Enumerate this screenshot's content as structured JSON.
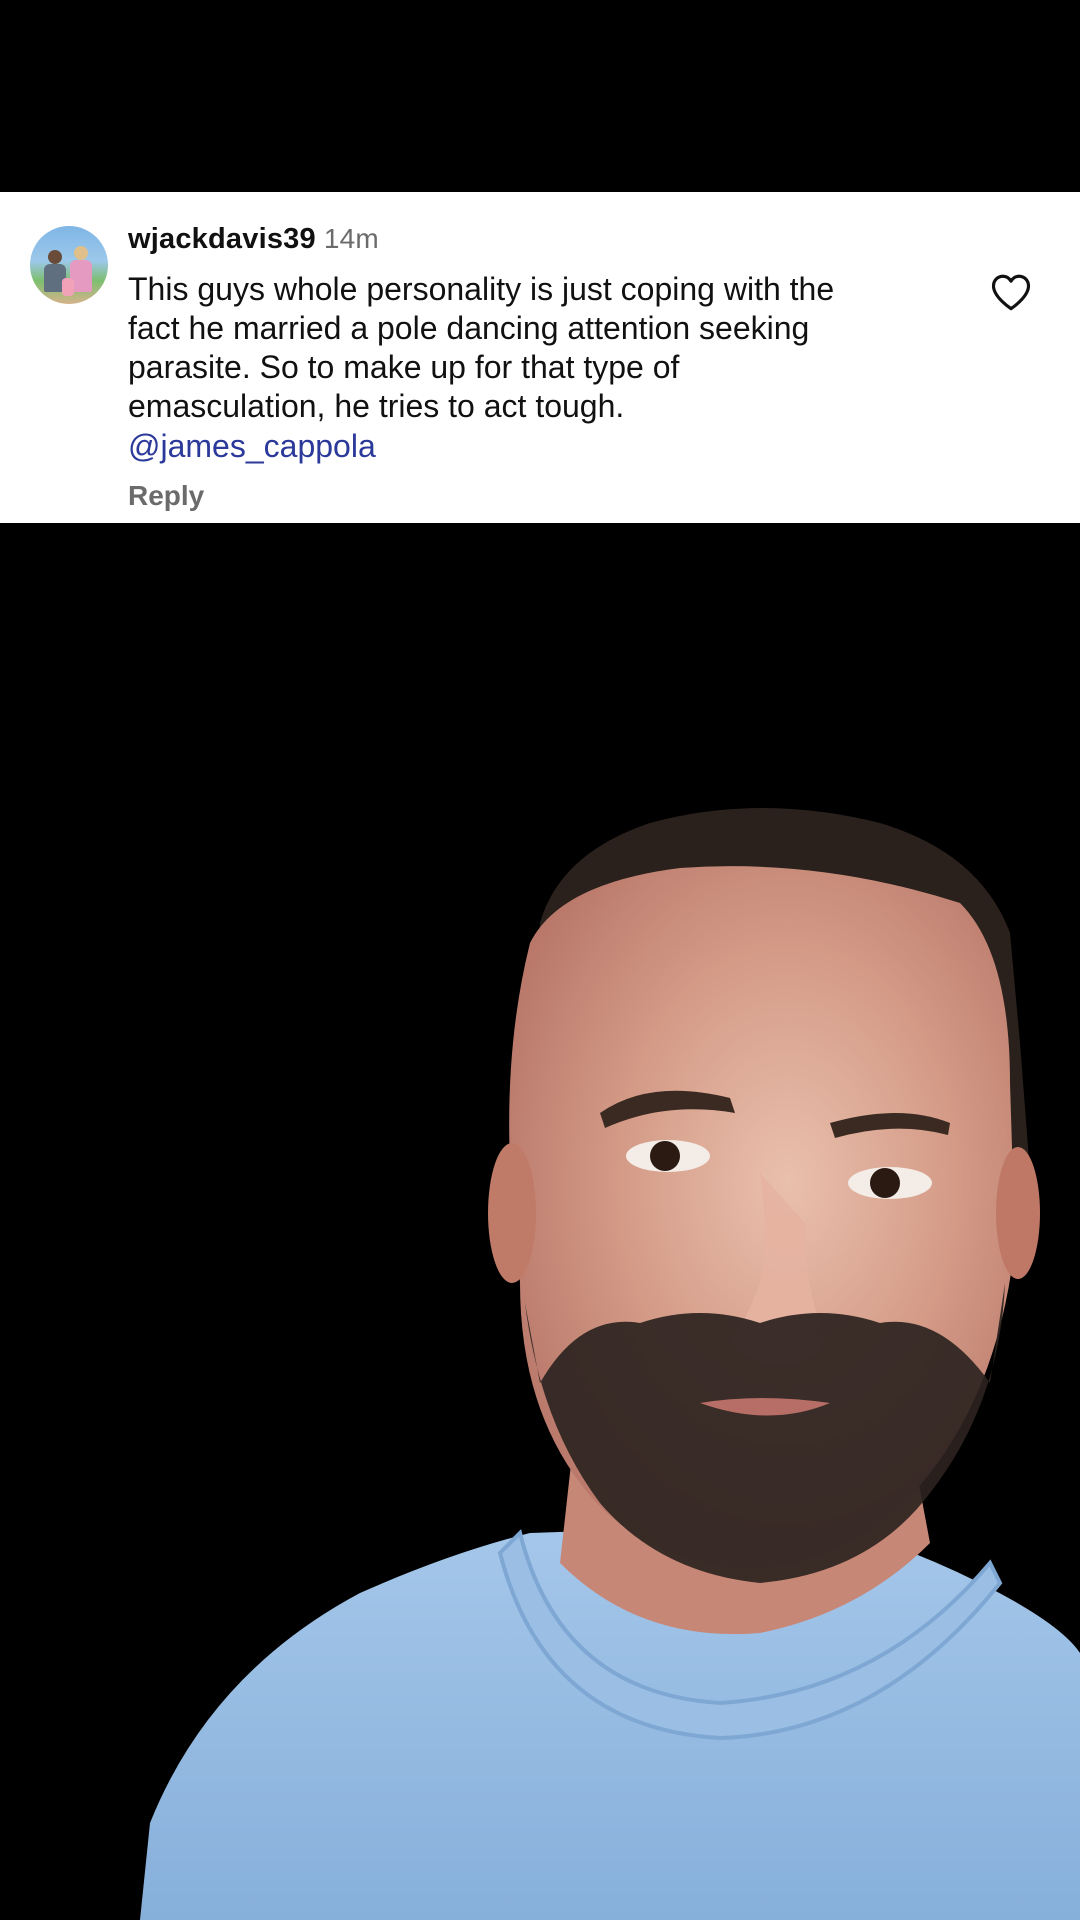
{
  "comment": {
    "username": "wjackdavis39",
    "timestamp": "14m",
    "lines": [
      "This guys whole personality is just coping with the",
      "fact he married a pole dancing attention seeking",
      "parasite. So to make up for that type of",
      "emasculation, he tries to act tough."
    ],
    "mention": "@james_cappola",
    "reply_label": "Reply",
    "like_icon": "heart-outline-icon"
  },
  "colors": {
    "mention": "#2b3a9a",
    "muted": "#6b6b6b",
    "sweater": "#8fb7df"
  }
}
